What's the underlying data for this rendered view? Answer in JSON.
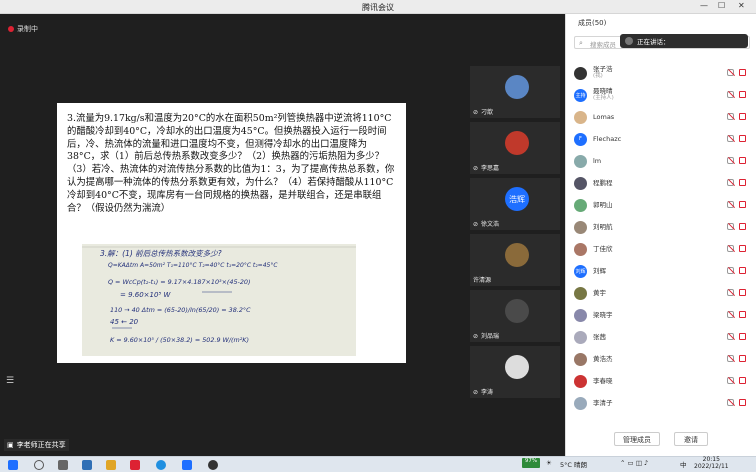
{
  "window": {
    "title": "腾讯会议"
  },
  "recording": {
    "label": "录制中"
  },
  "question": {
    "text": "3.流量为9.17kg/s和温度为20°C的水在面积50m²列管换热器中逆流将110°C的醋酸冷却到40°C，冷却水的出口温度为45°C。但换热器投入运行一段时间后，冷、热流体的流量和进口温度均不变，但测得冷却水的出口温度降为38°C，求（1）前后总传热系数改变多少？（2）换热器的污垢热阻为多少？（3）若冷、热流体的对流传热分系数的比值为1：3，为了提高传热总系数，你认为提高哪一种流体的传热分系数更有效，为什么？（4）若保持醋酸从110°C冷却到40°C不变，现库房有一台同规格的换热器，是并联组合，还是串联组合？（假设仍然为湍流）"
  },
  "board": {
    "lines": [
      "3.解：(1) 前后总传热系数改变多少?",
      "Q=KAΔtm    A=50m²   T₁=110°C  T₂=40°C  t₁=20°C  t₂=45°C",
      "Q = WcCp(t₂-t₁) = 9.17×4.187×10³×(45-20)",
      "= 9.60×10⁵ W",
      "110 → 40         Δtm = (65-20)/ln(65/20) = 38.2°C",
      "45 ← 20",
      "K = 9.60×10⁵ / (50×38.2) = 502.9 W/(m²K)"
    ]
  },
  "tiles": [
    {
      "name": "刁歆",
      "avatar": ""
    },
    {
      "name": "李思嘉",
      "avatar": ""
    },
    {
      "name": "徐文浩",
      "avatar": "浩辉"
    },
    {
      "name": "许清源",
      "avatar": ""
    },
    {
      "name": "刘品瑞",
      "avatar": ""
    },
    {
      "name": "李涛",
      "avatar": ""
    }
  ],
  "share": {
    "label": "李老师正在共享"
  },
  "panel": {
    "header": "成员(50)",
    "search_placeholder": "搜索成员",
    "invite": "邀请",
    "manage": "管理成员"
  },
  "toast": {
    "text": "正在讲话："
  },
  "participants": [
    {
      "name": "张子浩",
      "sub": "(我)",
      "av": ""
    },
    {
      "name": "聂晓晴",
      "sub": "(主持人)",
      "av": "主持"
    },
    {
      "name": "Lomas",
      "sub": "",
      "av": ""
    },
    {
      "name": "Flechazc",
      "sub": "",
      "av": "F"
    },
    {
      "name": "lm",
      "sub": "",
      "av": ""
    },
    {
      "name": "程鹏程",
      "sub": "",
      "av": ""
    },
    {
      "name": "郭明山",
      "sub": "",
      "av": ""
    },
    {
      "name": "刘明航",
      "sub": "",
      "av": ""
    },
    {
      "name": "丁佳欣",
      "sub": "",
      "av": ""
    },
    {
      "name": "刘辉",
      "sub": "",
      "av": "刘辉"
    },
    {
      "name": "黄宇",
      "sub": "",
      "av": ""
    },
    {
      "name": "梁晓宇",
      "sub": "",
      "av": ""
    },
    {
      "name": "张茜",
      "sub": "",
      "av": ""
    },
    {
      "name": "黄浩杰",
      "sub": "",
      "av": ""
    },
    {
      "name": "李春晓",
      "sub": "",
      "av": ""
    },
    {
      "name": "李清子",
      "sub": "",
      "av": ""
    }
  ],
  "taskbar": {
    "weather": "5°C 晴朗",
    "temp_badge": "97%",
    "time": "20:15",
    "date": "2022/12/11",
    "lang": "中"
  },
  "colors": {
    "accent": "#1e6fff",
    "danger": "#dd2233",
    "brand": "#1a73e8"
  }
}
